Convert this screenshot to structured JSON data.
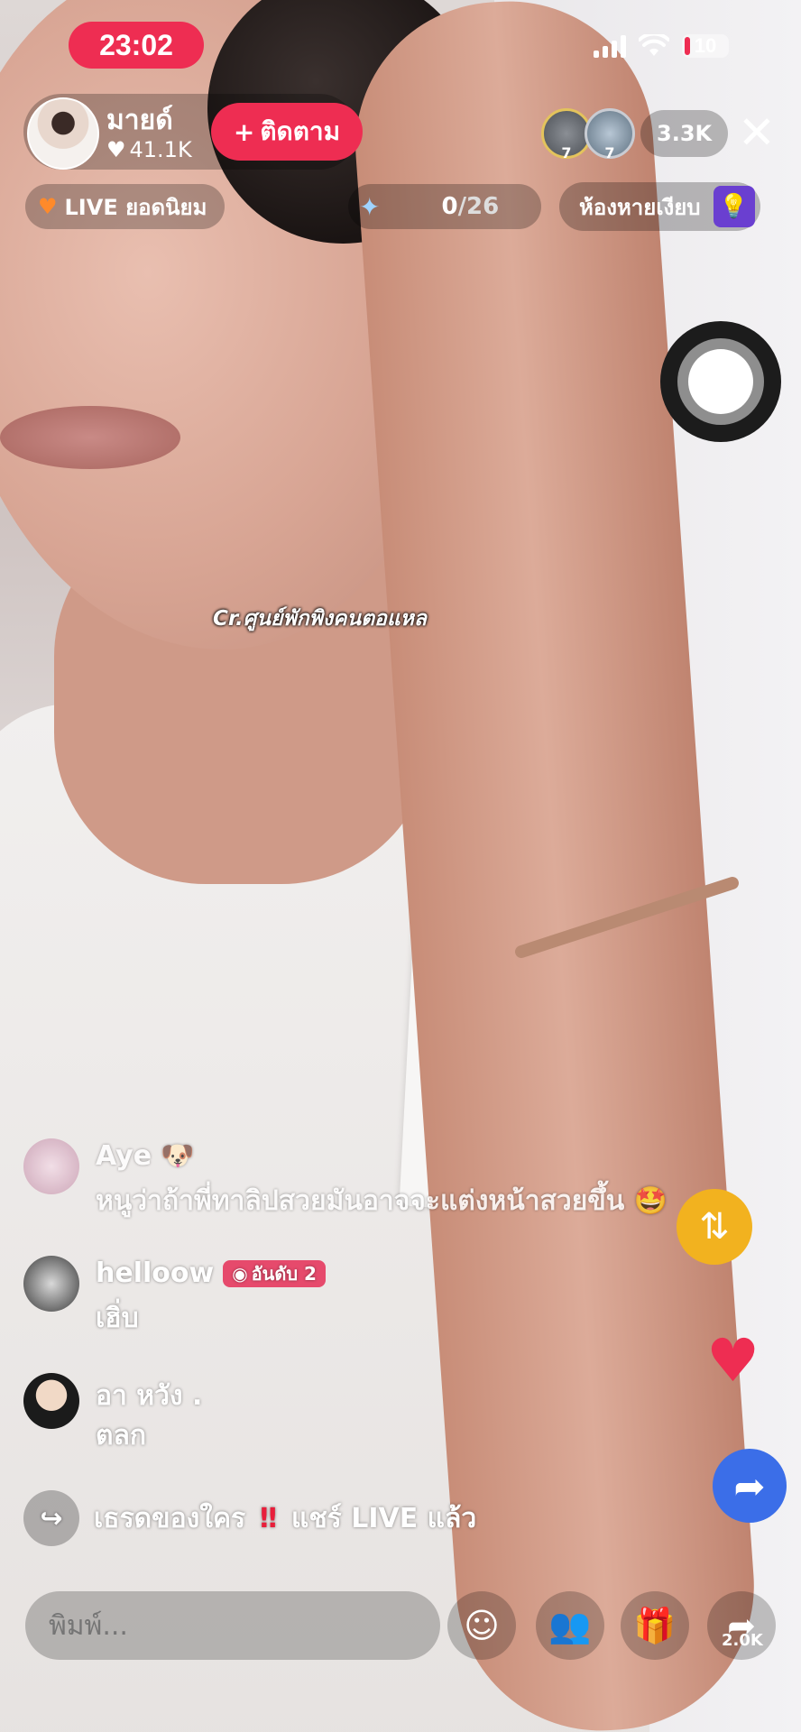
{
  "status_bar": {
    "time": "23:02",
    "battery": "10"
  },
  "host": {
    "name": "มายด์",
    "likes": "41.1K",
    "follow_label": "ติดตาม"
  },
  "viewers": {
    "top1_badge": "7",
    "top2_badge": "7",
    "count": "3.3K"
  },
  "live_rank": {
    "label": "LIVE ยอดนิยม"
  },
  "goal": {
    "current": "0",
    "total": "/26"
  },
  "room": {
    "label": "ห้องหายเงียบ"
  },
  "watermark": "Cr.ศูนย์พักพิงคนตอแหล",
  "chat": {
    "messages": [
      {
        "name": "Aye",
        "text": "หนูว่าถ้าพี่ทาลิปสวยมันอาจจะแต่งหน้าสวยขึ้น"
      },
      {
        "name": "helloow",
        "badge": "อันดับ 2",
        "text": "เฮิ่บ"
      },
      {
        "name": "อา หวัง .",
        "text": "ตลก"
      }
    ],
    "share_notice": {
      "name": "เธรดของใคร",
      "action": "แชร์ LIVE แล้ว"
    }
  },
  "bottom_bar": {
    "input_placeholder": "พิมพ์...",
    "share_count": "2.0K"
  },
  "colors": {
    "accent": "#ee2d52",
    "repost": "#f2b21f",
    "forward": "#3b6ee8"
  }
}
